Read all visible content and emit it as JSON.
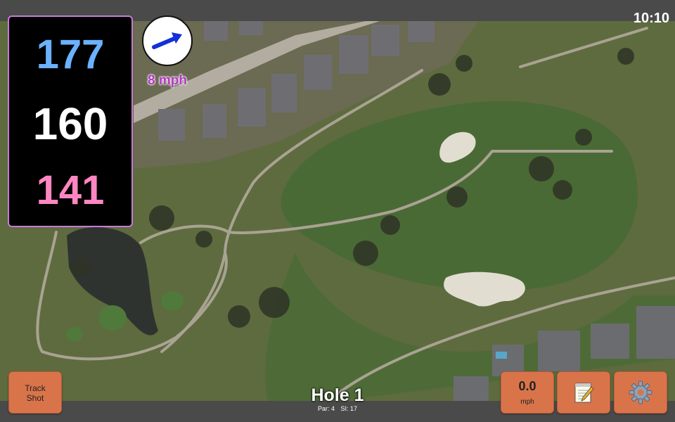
{
  "status": {
    "time": "10:10"
  },
  "distances": {
    "back": "177",
    "middle": "160",
    "front": "141"
  },
  "wind": {
    "speed": "8 mph",
    "icon": "arrow-icon"
  },
  "hole": {
    "title": "Hole 1",
    "par": "Par: 4",
    "si": "SI: 17"
  },
  "buttons": {
    "track_shot_line1": "Track",
    "track_shot_line2": "Shot",
    "speed_value": "0.0",
    "speed_unit": "mph",
    "notes_icon": "notepad-icon",
    "settings_icon": "gear-icon"
  },
  "colors": {
    "back_distance": "#6ab2ff",
    "middle_distance": "#ffffff",
    "front_distance": "#ff86c2",
    "button": "#d9744a",
    "wind_text": "#b339c0"
  }
}
